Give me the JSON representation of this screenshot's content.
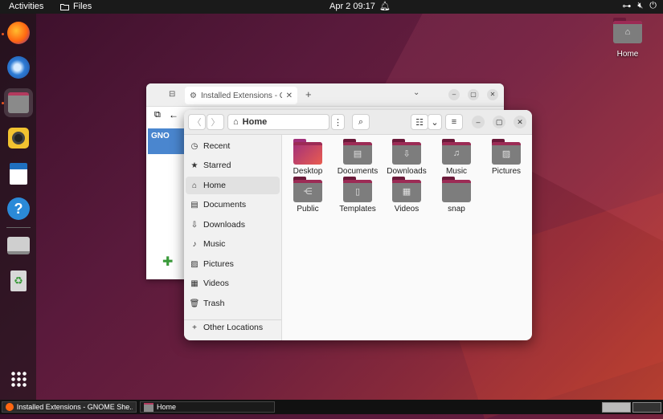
{
  "topbar": {
    "activities": "Activities",
    "app_name": "Files",
    "clock": "Apr 2  09:17"
  },
  "dock": {
    "items": [
      {
        "name": "firefox",
        "icon": "firefox-icon",
        "active": false
      },
      {
        "name": "thunderbird",
        "icon": "thunderbird-icon",
        "active": false
      },
      {
        "name": "files",
        "icon": "files-icon",
        "active": true
      },
      {
        "name": "rhythmbox",
        "icon": "rhythmbox-icon",
        "active": false
      },
      {
        "name": "writer",
        "icon": "writer-icon",
        "active": false
      },
      {
        "name": "help",
        "icon": "help-icon",
        "active": false
      },
      {
        "name": "drive",
        "icon": "drive-icon",
        "active": false
      },
      {
        "name": "trash",
        "icon": "trash-icon",
        "active": false
      },
      {
        "name": "app-grid",
        "icon": "app-grid-icon",
        "active": false
      }
    ]
  },
  "desktop": {
    "home_label": "Home"
  },
  "browser": {
    "tab_title": "Installed Extensions - GN",
    "banner_text": "GNO"
  },
  "files": {
    "path_label": "Home",
    "sidebar": [
      {
        "label": "Recent",
        "icon": "clock-icon"
      },
      {
        "label": "Starred",
        "icon": "star-icon"
      },
      {
        "label": "Home",
        "icon": "home-icon",
        "selected": true
      },
      {
        "label": "Documents",
        "icon": "document-icon"
      },
      {
        "label": "Downloads",
        "icon": "download-icon"
      },
      {
        "label": "Music",
        "icon": "music-icon"
      },
      {
        "label": "Pictures",
        "icon": "picture-icon"
      },
      {
        "label": "Videos",
        "icon": "video-icon"
      },
      {
        "label": "Trash",
        "icon": "trash-icon"
      }
    ],
    "other_locations": "Other Locations",
    "folders": [
      {
        "label": "Desktop",
        "icon": "desktop-folder-icon"
      },
      {
        "label": "Documents",
        "icon": "documents-folder-icon"
      },
      {
        "label": "Downloads",
        "icon": "downloads-folder-icon"
      },
      {
        "label": "Music",
        "icon": "music-folder-icon"
      },
      {
        "label": "Pictures",
        "icon": "pictures-folder-icon"
      },
      {
        "label": "Public",
        "icon": "public-folder-icon"
      },
      {
        "label": "Templates",
        "icon": "templates-folder-icon"
      },
      {
        "label": "Videos",
        "icon": "videos-folder-icon"
      },
      {
        "label": "snap",
        "icon": "snap-folder-icon"
      }
    ]
  },
  "taskbar": {
    "items": [
      {
        "label": "Installed Extensions - GNOME She..."
      },
      {
        "label": "Home"
      }
    ]
  },
  "colors": {
    "accent": "#e95420",
    "folder_gray": "#7d7d7d",
    "folder_tab": "#9c2b55"
  }
}
